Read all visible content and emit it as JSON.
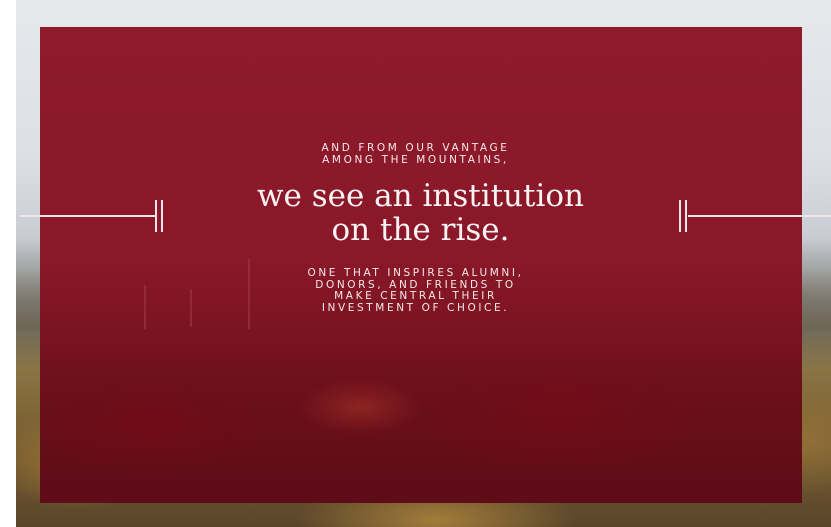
{
  "hero": {
    "kicker_lines": [
      "AND FROM OUR VANTAGE",
      "AMONG THE MOUNTAINS,"
    ],
    "headline_lines": [
      "we see an institution",
      "on the rise."
    ],
    "sub_lines": [
      "ONE THAT INSPIRES ALUMNI,",
      "DONORS, AND FRIENDS TO",
      "MAKE CENTRAL THEIR",
      "INVESTMENT OF CHOICE."
    ]
  },
  "colors": {
    "overlay_red": "#8e1a2b",
    "text": "#fbf3f3"
  }
}
